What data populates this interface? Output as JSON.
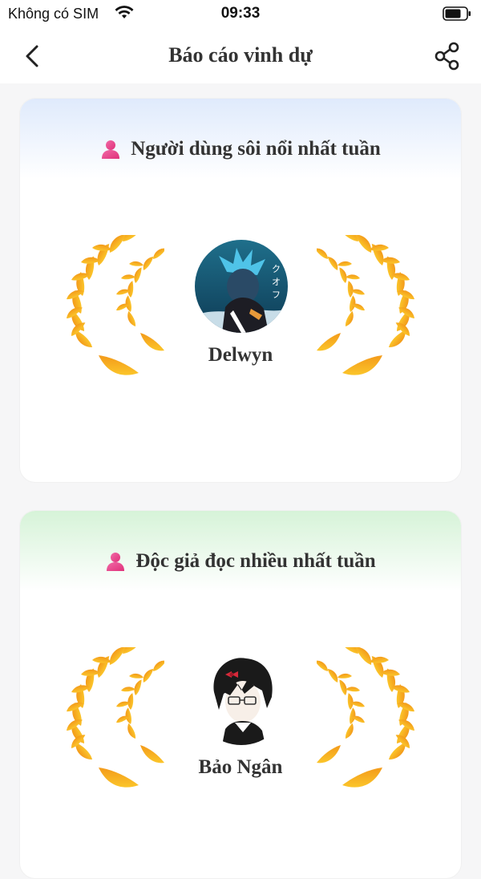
{
  "status_bar": {
    "carrier": "Không có SIM",
    "time": "09:33",
    "wifi_icon": "wifi-icon",
    "battery_icon": "battery-icon"
  },
  "nav": {
    "title": "Báo cáo vinh dự",
    "back_icon": "chevron-left-icon",
    "share_icon": "share-icon"
  },
  "cards": [
    {
      "title": "Người dùng sôi nổi nhất tuần",
      "icon": "user-icon",
      "winner_name": "Delwyn",
      "header_color": "#dfeafc"
    },
    {
      "title": "Độc giả đọc nhiều nhất tuần",
      "icon": "user-icon",
      "winner_name": "Bảo Ngân",
      "header_color": "#d6f3d8"
    }
  ],
  "colors": {
    "accent_pink": "#e8418a",
    "wreath_gold": "#f7b21a",
    "wreath_orange": "#f08a1c"
  }
}
